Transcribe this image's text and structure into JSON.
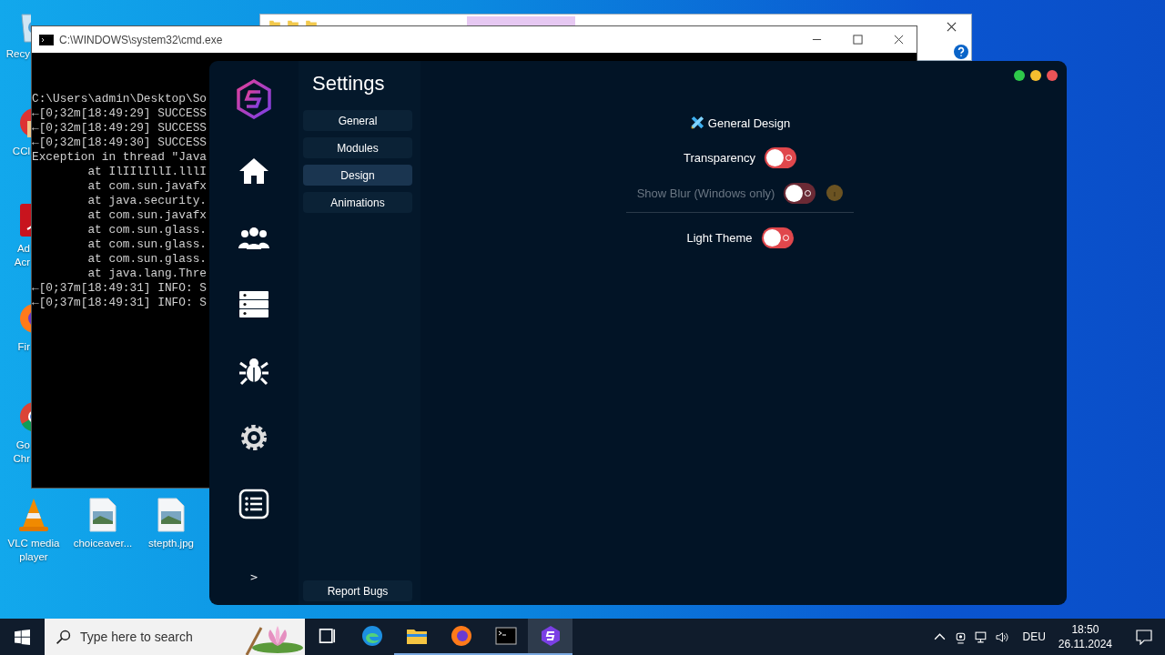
{
  "desktop_icons": [
    {
      "kind": "recycle",
      "label": "Recy"
    },
    {
      "kind": "ccleaner",
      "label": "CCl"
    },
    {
      "kind": "acrobat",
      "label": "Ad Acr"
    },
    {
      "kind": "firefox",
      "label": "Fir"
    },
    {
      "kind": "chrome",
      "label": "Go Chr"
    },
    {
      "kind": "vlc",
      "label": "VLC media player"
    },
    {
      "kind": "image",
      "label": "choiceaver..."
    },
    {
      "kind": "image",
      "label": "stepth.jpg"
    }
  ],
  "terminal": {
    "title": "C:\\WINDOWS\\system32\\cmd.exe",
    "lines": [
      "C:\\Users\\admin\\Desktop\\So",
      "←[0;32m[18:49:29] SUCCESS",
      "←[0;32m[18:49:29] SUCCESS",
      "←[0;32m[18:49:30] SUCCESS",
      "Exception in thread \"Java",
      "        at IlIIlIllI.lllI",
      "        at com.sun.javafx",
      "        at java.security.",
      "        at com.sun.javafx",
      "        at com.sun.glass.",
      "        at com.sun.glass.",
      "        at com.sun.glass.",
      "        at java.lang.Thre",
      "←[0;37m[18:49:31] INFO: S",
      "←[0;37m[18:49:31] INFO: S"
    ]
  },
  "settings": {
    "title": "Settings",
    "window_buttons": [
      {
        "color": "#2ec94a"
      },
      {
        "color": "#f5bd2f"
      },
      {
        "color": "#ec5357"
      }
    ],
    "nav": [
      {
        "kind": "home"
      },
      {
        "kind": "users"
      },
      {
        "kind": "server"
      },
      {
        "kind": "bug"
      },
      {
        "kind": "gear"
      },
      {
        "kind": "list"
      }
    ],
    "expand_label": ">",
    "tabs": [
      {
        "label": "General",
        "selected": false
      },
      {
        "label": "Modules",
        "selected": false
      },
      {
        "label": "Design",
        "selected": true
      },
      {
        "label": "Animations",
        "selected": false
      }
    ],
    "report_button": "Report Bugs",
    "section_title": "General Design",
    "options": [
      {
        "kind": "toggle",
        "label": "Transparency",
        "on": false,
        "disabled": false,
        "info": false
      },
      {
        "kind": "toggle",
        "label": "Show Blur (Windows only)",
        "on": false,
        "disabled": true,
        "info": true
      },
      {
        "kind": "divider"
      },
      {
        "kind": "toggle",
        "label": "Light Theme",
        "on": false,
        "disabled": false,
        "info": false
      }
    ]
  },
  "taskbar": {
    "search_placeholder": "Type here to search",
    "apps": [
      {
        "kind": "taskview",
        "running": false,
        "selected": false
      },
      {
        "kind": "edge",
        "running": false,
        "selected": false
      },
      {
        "kind": "explorer",
        "running": true,
        "selected": false
      },
      {
        "kind": "firefox",
        "running": true,
        "selected": false
      },
      {
        "kind": "terminal",
        "running": true,
        "selected": false
      },
      {
        "kind": "app",
        "running": true,
        "selected": true
      }
    ],
    "language": "DEU",
    "time": "18:50",
    "date": "26.11.2024"
  }
}
